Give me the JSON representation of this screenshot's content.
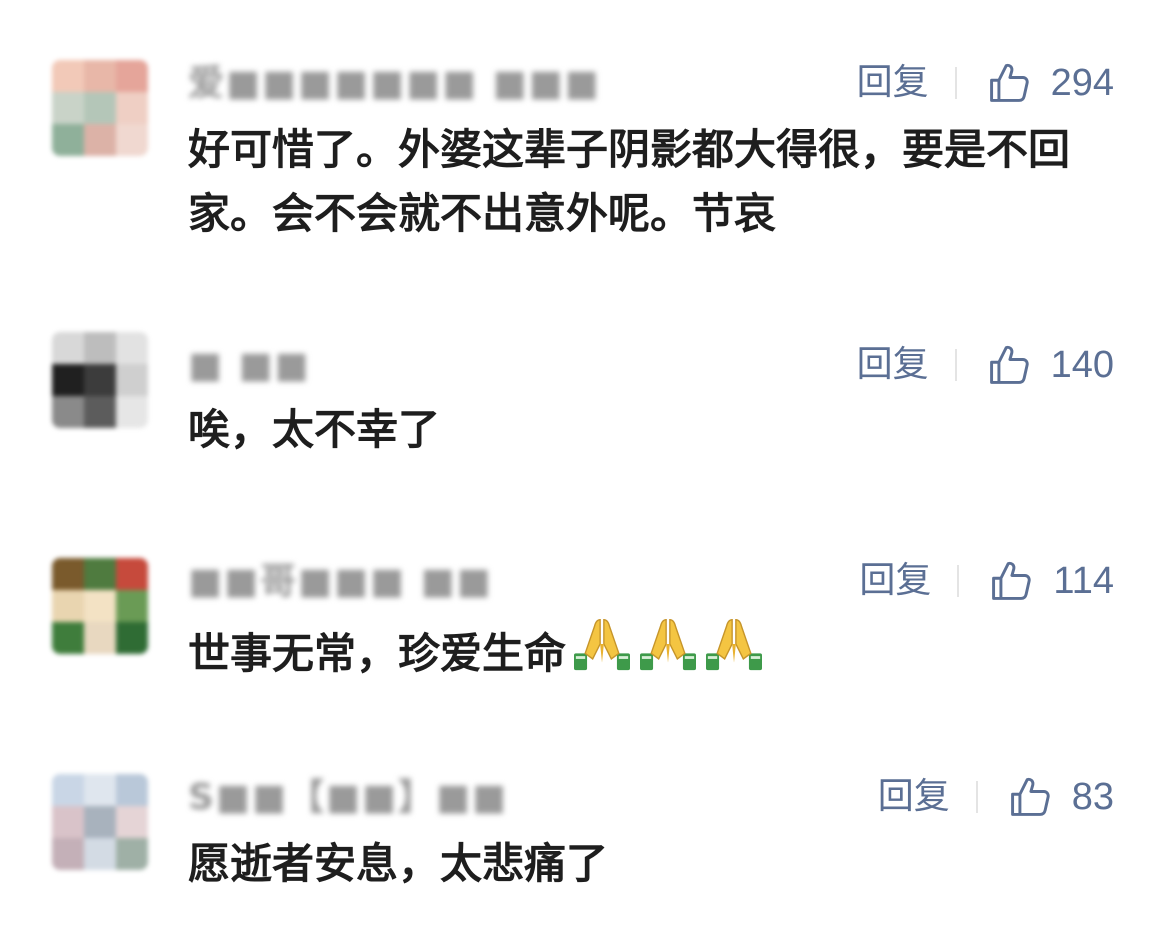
{
  "comments": [
    {
      "username": "爱■■■■■■■ ■■■",
      "text": "好可惜了。外婆这辈子阴影都大得很，要是不回家。会不会就不出意外呢。节哀",
      "reply_label": "回复",
      "likes": "294",
      "avatar_colors": [
        "#f2c9b8",
        "#e8b7a8",
        "#e5a59a",
        "#c9d3c8",
        "#b4c6b8",
        "#efcfc4",
        "#8fb09a",
        "#dcb2a7",
        "#f0d8d0"
      ]
    },
    {
      "username": "■ ■■",
      "text": "唉，太不幸了",
      "reply_label": "回复",
      "likes": "140",
      "avatar_colors": [
        "#d8d8d8",
        "#bdbdbd",
        "#e2e2e2",
        "#202020",
        "#3c3c3c",
        "#cfcfcf",
        "#8a8a8a",
        "#5c5c5c",
        "#e6e6e6"
      ]
    },
    {
      "username": "■■哥■■■ ■■",
      "text": "世事无常，珍爱生命",
      "emoji": [
        "folded-hands",
        "folded-hands",
        "folded-hands"
      ],
      "reply_label": "回复",
      "likes": "114",
      "avatar_colors": [
        "#7a5a2c",
        "#4f7b3f",
        "#c64a3c",
        "#e9d5b0",
        "#f3e2c4",
        "#6a9b55",
        "#3f7d3c",
        "#e8d8c0",
        "#2f6c34"
      ]
    },
    {
      "username": "S■■【■■】■■",
      "text": "愿逝者安息，太悲痛了",
      "reply_label": "回复",
      "likes": "83",
      "avatar_colors": [
        "#c9d6e6",
        "#dfe6ee",
        "#b9c8d9",
        "#d9c3c9",
        "#a8b2bd",
        "#e5d4d6",
        "#c4b0b8",
        "#d3dbe4",
        "#9fb0a6"
      ]
    }
  ],
  "colors": {
    "text": "#1e1e1e",
    "action": "#5b6f94",
    "username": "#9a9a9a"
  }
}
